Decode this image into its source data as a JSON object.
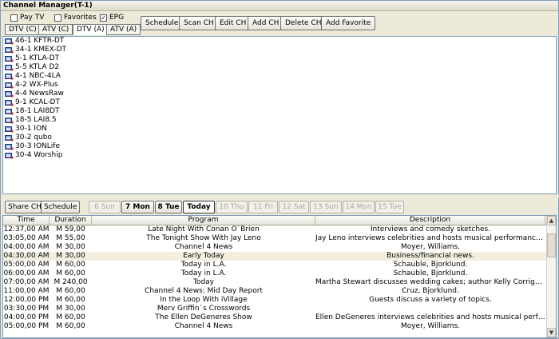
{
  "window": {
    "title": "Channel Manager(T-1)"
  },
  "filters": [
    {
      "label": "Pay TV",
      "checked": false
    },
    {
      "label": "Favorites",
      "checked": false
    },
    {
      "label": "EPG",
      "checked": true
    }
  ],
  "source_tabs": [
    "DTV (C)",
    "ATV (C)",
    "DTV (A)",
    "ATV (A)"
  ],
  "active_source_tab": "DTV (A)",
  "actions": [
    "Scheduler",
    "Scan CH",
    "Edit CH",
    "Add CH",
    "Delete CH",
    "Add Favorite"
  ],
  "channels": [
    "46-1 KFTR-DT",
    "34-1 KMEX-DT",
    "5-1 KTLA-DT",
    "5-5 KTLA D2",
    "4-1 NBC-4LA",
    "4-2 WX-Plus",
    "4-4 NewsRaw",
    "9-1 KCAL-DT",
    "18-1 LAI8DT",
    "18-5 LAI8.5",
    "30-1 ION",
    "30-2 qubo",
    "30-3 IONLife",
    "30-4 Worship"
  ],
  "bottom_buttons": {
    "share": "Share CH",
    "schedule": "Schedule"
  },
  "days": [
    {
      "label": "6 Sun",
      "state": "disabled"
    },
    {
      "label": "7 Mon",
      "state": "enabled"
    },
    {
      "label": "8 Tue",
      "state": "enabled"
    },
    {
      "label": "Today",
      "state": "current"
    },
    {
      "label": "10 Thu",
      "state": "disabled"
    },
    {
      "label": "11 Fri",
      "state": "disabled"
    },
    {
      "label": "12 Sat",
      "state": "disabled"
    },
    {
      "label": "13 Sun",
      "state": "disabled"
    },
    {
      "label": "14 Mon",
      "state": "disabled"
    },
    {
      "label": "15 Tue",
      "state": "disabled"
    }
  ],
  "schedule_columns": [
    "Time",
    "Duration",
    "Program",
    "Description"
  ],
  "schedule_rows": [
    {
      "time": "12:37,00 AM",
      "duration": "M 59,00",
      "program": "Late Night With Conan O`Brien",
      "description": "Interviews and comedy sketches."
    },
    {
      "time": "03:05,00 AM",
      "duration": "M 55,00",
      "program": "The Tonight Show With Jay Leno",
      "description": "Jay Leno interviews celebrities and hosts musical performances."
    },
    {
      "time": "04:00,00 AM",
      "duration": "M 30,00",
      "program": "Channel 4 News",
      "description": "Moyer, Williams."
    },
    {
      "time": "04:30,00 AM",
      "duration": "M 30,00",
      "program": "Early Today",
      "description": "Business/financial news.",
      "selected": true
    },
    {
      "time": "05:00,00 AM",
      "duration": "M 60,00",
      "program": "Today in L.A.",
      "description": "Schauble, Bjorklund."
    },
    {
      "time": "06:00,00 AM",
      "duration": "M 60,00",
      "program": "Today in L.A.",
      "description": "Schauble, Bjorklund."
    },
    {
      "time": "07:00,00 AM",
      "duration": "M 240,00",
      "program": "Today",
      "description": "Martha Stewart discusses wedding cakes; author Kelly Corrigan (``Th..."
    },
    {
      "time": "11:00,00 AM",
      "duration": "M 60,00",
      "program": "Channel 4 News: Mid Day Report",
      "description": "Cruz, Bjorklund."
    },
    {
      "time": "12:00,00 PM",
      "duration": "M 60,00",
      "program": "In the Loop With iVillage",
      "description": "Guests discuss a variety of topics."
    },
    {
      "time": "03:30,00 PM",
      "duration": "M 30,00",
      "program": "Merv Griffin`s Crosswords",
      "description": ""
    },
    {
      "time": "04:00,00 PM",
      "duration": "M 60,00",
      "program": "The Ellen DeGeneres Show",
      "description": "Ellen DeGeneres interviews celebrities and hosts musical performanc..."
    },
    {
      "time": "05:00,00 PM",
      "duration": "M 60,00",
      "program": "Channel 4 News",
      "description": "Moyer, Williams."
    }
  ]
}
